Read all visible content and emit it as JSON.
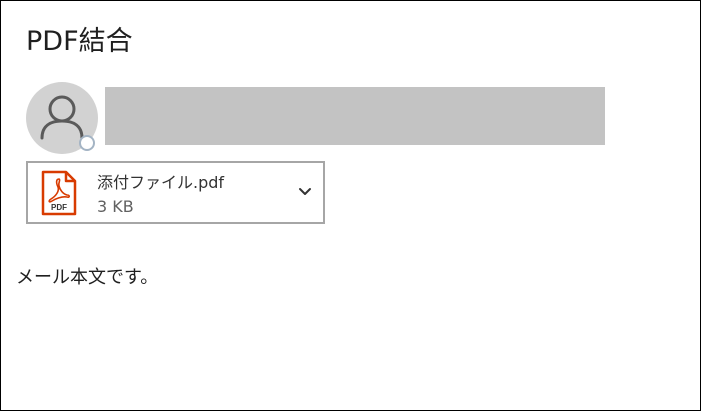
{
  "message": {
    "subject": "PDF結合",
    "body": "メール本文です。"
  },
  "sender": {
    "avatar_icon": "person-icon",
    "presence_icon": "presence-status-icon",
    "name_redacted": true
  },
  "attachment": {
    "file_name": "添付ファイル.pdf",
    "file_size": "3 KB",
    "file_type_icon": "pdf-file-icon",
    "pdf_badge_text": "PDF",
    "menu_icon": "chevron-down-icon"
  },
  "colors": {
    "pdf_red": "#d83b01",
    "avatar_background": "#d2d2d2",
    "redaction": "#c3c3c3",
    "attachment_border": "#a6a6a6"
  }
}
